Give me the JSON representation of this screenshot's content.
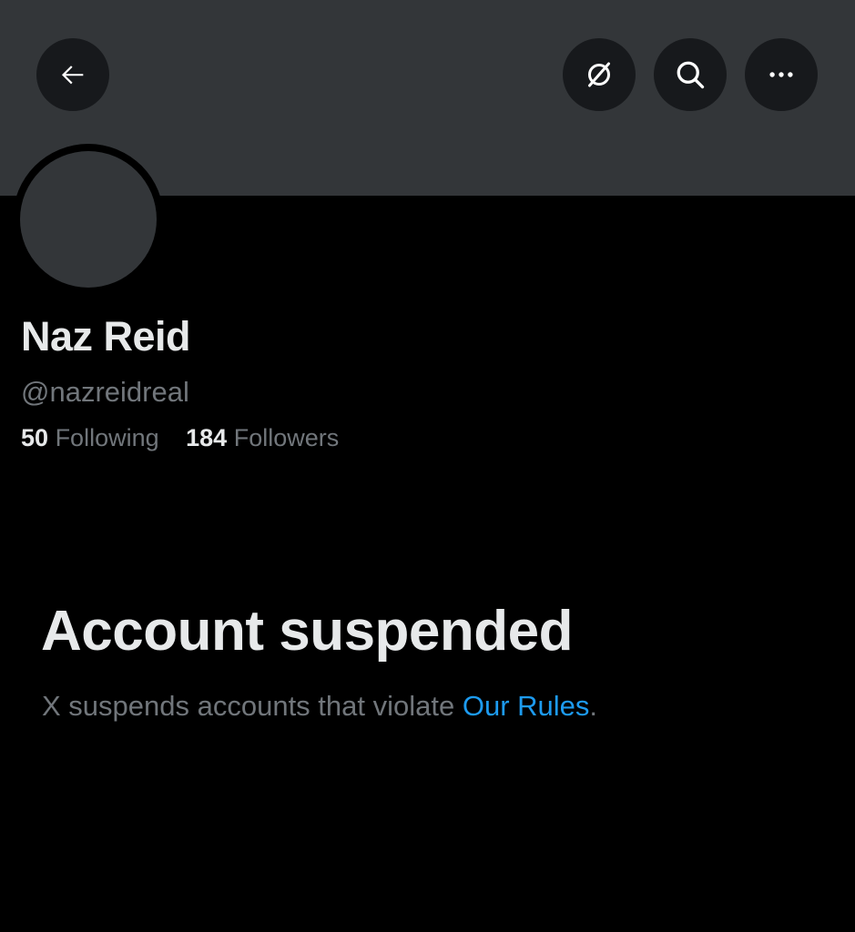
{
  "header": {
    "back_icon": "arrow-left-icon",
    "grok_icon": "grok-slash-icon",
    "search_icon": "search-icon",
    "more_icon": "more-horizontal-icon"
  },
  "profile": {
    "display_name": "Naz Reid",
    "handle": "@nazreidreal",
    "following_count": "50",
    "following_label": "Following",
    "followers_count": "184",
    "followers_label": "Followers"
  },
  "suspension": {
    "title": "Account suspended",
    "message": "X suspends accounts that violate",
    "link_text": "Our Rules",
    "trailing": "."
  },
  "colors": {
    "background": "#000000",
    "banner": "#333639",
    "primary_text": "#e7e9ea",
    "secondary_text": "#71767b",
    "link": "#1d9bf0"
  }
}
